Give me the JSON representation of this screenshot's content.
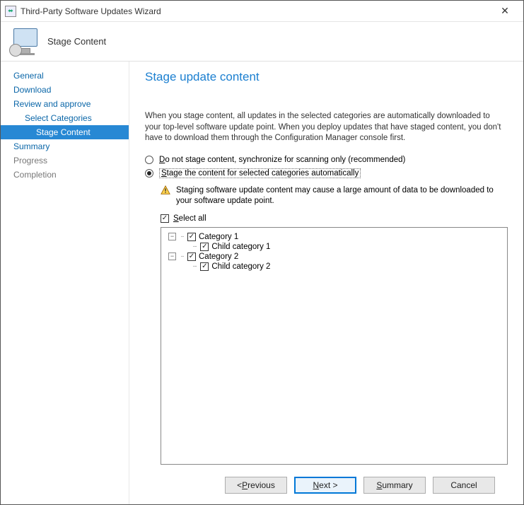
{
  "window": {
    "title": "Third-Party Software Updates Wizard"
  },
  "header": {
    "label": "Stage Content"
  },
  "sidebar": {
    "items": [
      {
        "label": "General",
        "level": 0,
        "active": false,
        "muted": false
      },
      {
        "label": "Download",
        "level": 0,
        "active": false,
        "muted": false
      },
      {
        "label": "Review and approve",
        "level": 0,
        "active": false,
        "muted": false
      },
      {
        "label": "Select Categories",
        "level": 1,
        "active": false,
        "muted": false
      },
      {
        "label": "Stage Content",
        "level": 2,
        "active": true,
        "muted": false
      },
      {
        "label": "Summary",
        "level": 0,
        "active": false,
        "muted": false
      },
      {
        "label": "Progress",
        "level": 0,
        "active": false,
        "muted": true
      },
      {
        "label": "Completion",
        "level": 0,
        "active": false,
        "muted": true
      }
    ]
  },
  "main": {
    "title": "Stage update content",
    "description": "When you stage content, all updates in the selected categories are automatically downloaded to your top-level software update point. When you deploy updates that have staged content, you don't have to download them through the Configuration Manager console first.",
    "radio_no_stage_prefix": "D",
    "radio_no_stage_rest": "o not stage content, synchronize for scanning only (recommended)",
    "radio_stage_prefix": "S",
    "radio_stage_rest": "tage the content for selected categories automatically",
    "radio_selected": "stage",
    "warning": "Staging software update content may cause a large amount of data to be downloaded to your software update point.",
    "select_all_prefix": "S",
    "select_all_rest": "elect all",
    "select_all_checked": true,
    "tree": [
      {
        "label": "Category 1",
        "level": 1,
        "expanded": true,
        "checked": true
      },
      {
        "label": "Child category 1",
        "level": 2,
        "expanded": null,
        "checked": true
      },
      {
        "label": "Category 2",
        "level": 1,
        "expanded": true,
        "checked": true
      },
      {
        "label": "Child category 2",
        "level": 2,
        "expanded": null,
        "checked": true
      }
    ]
  },
  "footer": {
    "previous_prefix": "P",
    "previous_rest": "revious",
    "next_prefix": "N",
    "next_rest": "ext >",
    "summary_prefix": "S",
    "summary_rest": "ummary",
    "cancel": "Cancel"
  }
}
